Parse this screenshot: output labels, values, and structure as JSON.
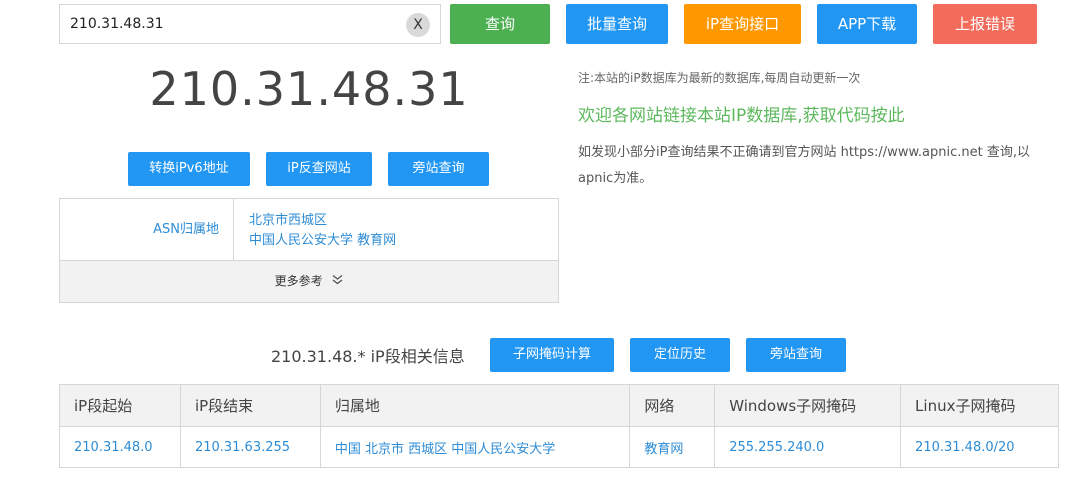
{
  "search": {
    "value": "210.31.48.31",
    "clear_label": "X"
  },
  "toolbar": {
    "query_label": "查询",
    "batch_label": "批量查询",
    "api_label": "iP查询接口",
    "app_label": "APP下载",
    "report_label": "上报错误"
  },
  "result": {
    "ip": "210.31.48.31",
    "buttons": {
      "ipv6": "转换iPv6地址",
      "reverse": "iP反查网站",
      "sidesite": "旁站查询"
    },
    "asn_label": "ASN归属地",
    "asn_line1": "北京市西城区",
    "asn_line2": "中国人民公安大学 教育网",
    "more_label": "更多参考"
  },
  "notes": {
    "note1": "注:本站的iP数据库为最新的数据库,每周自动更新一次",
    "note2": "欢迎各网站链接本站IP数据库,获取代码按此",
    "note3": "如发现小部分iP查询结果不正确请到官方网站 https://www.apnic.net 查询,以apnic为准。"
  },
  "segment": {
    "title": "210.31.48.* iP段相关信息",
    "buttons": {
      "subnet": "子网掩码计算",
      "history": "定位历史",
      "sidesite": "旁站查询"
    },
    "headers": [
      "iP段起始",
      "iP段结束",
      "归属地",
      "网络",
      "Windows子网掩码",
      "Linux子网掩码"
    ],
    "row": [
      "210.31.48.0",
      "210.31.63.255",
      "中国 北京市 西城区 中国人民公安大学",
      "教育网",
      "255.255.240.0",
      "210.31.48.0/20"
    ]
  },
  "colors": {
    "green": "#4caf50",
    "blue": "#2196f3",
    "orange": "#ff9800",
    "red": "#f26b5b",
    "link": "#2d8cd6"
  },
  "icons": {
    "more": "chevron-double-down-icon",
    "clear": "close-icon"
  }
}
